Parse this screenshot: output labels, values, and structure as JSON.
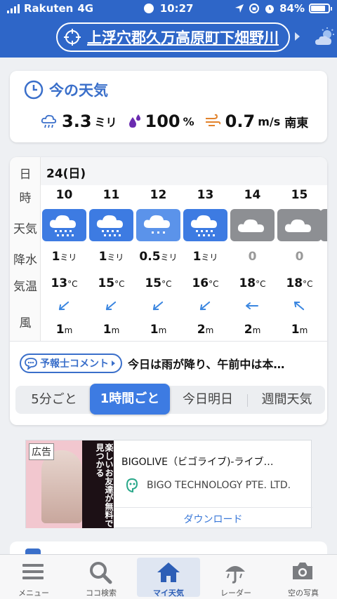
{
  "status": {
    "carrier": "Rakuten",
    "network": "4G",
    "time": "10:27",
    "battery": "84%"
  },
  "header": {
    "location": "上浮穴郡久万高原町下畑野川"
  },
  "now": {
    "title": "今の天気",
    "rain_value": "3.3",
    "rain_unit": "ミリ",
    "humidity_value": "100",
    "humidity_unit": "%",
    "wind_value": "0.7",
    "wind_unit": "m/s",
    "wind_dir": "南東"
  },
  "forecast": {
    "row_labels": {
      "day": "日",
      "hour": "時",
      "weather": "天気",
      "rain": "降水",
      "temp": "気温",
      "wind": "風"
    },
    "day": "24(日)",
    "hours": [
      {
        "hour": "10",
        "weather": "rain-heavy-icon",
        "rain": "1",
        "rain_unit": "ミリ",
        "temp": "13",
        "wind": "1",
        "wind_dir": "NW"
      },
      {
        "hour": "11",
        "weather": "rain-heavy-icon",
        "rain": "1",
        "rain_unit": "ミリ",
        "temp": "15",
        "wind": "1",
        "wind_dir": "NW"
      },
      {
        "hour": "12",
        "weather": "rain-light-icon",
        "rain": "0.5",
        "rain_unit": "ミリ",
        "temp": "15",
        "wind": "1",
        "wind_dir": "NW"
      },
      {
        "hour": "13",
        "weather": "rain-heavy-icon",
        "rain": "1",
        "rain_unit": "ミリ",
        "temp": "16",
        "wind": "2",
        "wind_dir": "NW"
      },
      {
        "hour": "14",
        "weather": "cloudy-icon",
        "rain": "0",
        "rain_unit": "",
        "temp": "18",
        "wind": "2",
        "wind_dir": "W"
      },
      {
        "hour": "15",
        "weather": "cloudy-icon",
        "rain": "0",
        "rain_unit": "",
        "temp": "18",
        "wind": "1",
        "wind_dir": "SW"
      }
    ],
    "temp_unit": "°C",
    "wind_unit": "m"
  },
  "comment": {
    "button": "予報士コメント",
    "text": "今日は雨が降り、午前中は本…"
  },
  "segments": [
    "5分ごと",
    "1時間ごと",
    "今日明日",
    "週間天気"
  ],
  "active_segment": "1時間ごと",
  "ad": {
    "tag": "広告",
    "image_text": "楽しいお友達が無料で見つかる",
    "title": "BIGOLIVE（ビゴライブ)-ライブ…",
    "company": "BIGO TECHNOLOGY PTE. LTD.",
    "download": "ダウンロード"
  },
  "tabs": [
    {
      "label": "メニュー",
      "icon": "menu-icon"
    },
    {
      "label": "ココ検索",
      "icon": "search-icon"
    },
    {
      "label": "マイ天気",
      "icon": "home-icon"
    },
    {
      "label": "レーダー",
      "icon": "radar-umbrella-icon"
    },
    {
      "label": "空の写真",
      "icon": "camera-icon"
    }
  ],
  "colors": {
    "brand": "#2e66c8",
    "rain_icon_bg": "#3d7be2",
    "rain_light_bg": "#5b93ea",
    "cloud_bg": "#8d8f93",
    "accent": "#3a6fca"
  }
}
